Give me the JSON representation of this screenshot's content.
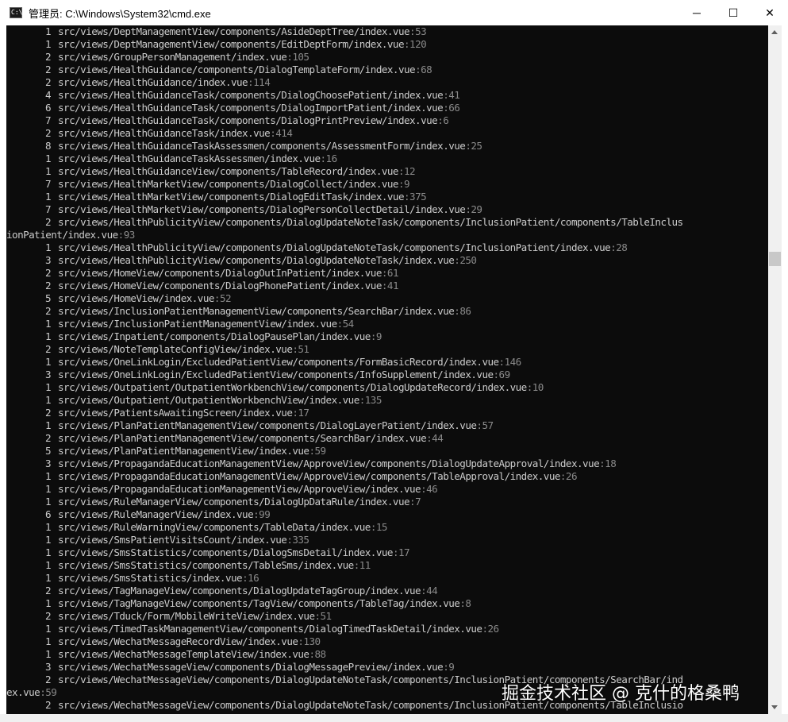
{
  "window": {
    "title": "管理员: C:\\Windows\\System32\\cmd.exe",
    "icon": "cmd-icon",
    "minimize": "─",
    "maximize": "☐",
    "close": "✕"
  },
  "colors": {
    "console_bg": "#0c0c0c",
    "console_text": "#cccccc",
    "line_number_text": "#8a8a8a"
  },
  "lines": [
    {
      "count": "1",
      "path": "src/views/DeptManagementView/components/AsideDeptTree/index.vue",
      "ln": ":53"
    },
    {
      "count": "1",
      "path": "src/views/DeptManagementView/components/EditDeptForm/index.vue",
      "ln": ":120"
    },
    {
      "count": "2",
      "path": "src/views/GroupPersonManagement/index.vue",
      "ln": ":105"
    },
    {
      "count": "2",
      "path": "src/views/HealthGuidance/components/DialogTemplateForm/index.vue",
      "ln": ":68"
    },
    {
      "count": "2",
      "path": "src/views/HealthGuidance/index.vue",
      "ln": ":114"
    },
    {
      "count": "4",
      "path": "src/views/HealthGuidanceTask/components/DialogChoosePatient/index.vue",
      "ln": ":41"
    },
    {
      "count": "6",
      "path": "src/views/HealthGuidanceTask/components/DialogImportPatient/index.vue",
      "ln": ":66"
    },
    {
      "count": "7",
      "path": "src/views/HealthGuidanceTask/components/DialogPrintPreview/index.vue",
      "ln": ":6"
    },
    {
      "count": "2",
      "path": "src/views/HealthGuidanceTask/index.vue",
      "ln": ":414"
    },
    {
      "count": "8",
      "path": "src/views/HealthGuidanceTaskAssessmen/components/AssessmentForm/index.vue",
      "ln": ":25"
    },
    {
      "count": "1",
      "path": "src/views/HealthGuidanceTaskAssessmen/index.vue",
      "ln": ":16"
    },
    {
      "count": "1",
      "path": "src/views/HealthGuidanceView/components/TableRecord/index.vue",
      "ln": ":12"
    },
    {
      "count": "7",
      "path": "src/views/HealthMarketView/components/DialogCollect/index.vue",
      "ln": ":9"
    },
    {
      "count": "1",
      "path": "src/views/HealthMarketView/components/DialogEditTask/index.vue",
      "ln": ":375"
    },
    {
      "count": "7",
      "path": "src/views/HealthMarketView/components/DialogPersonCollectDetail/index.vue",
      "ln": ":29"
    },
    {
      "count": "2",
      "path": "src/views/HealthPublicityView/components/DialogUpdateNoteTask/components/InclusionPatient/components/TableInclus",
      "ln": ""
    },
    {
      "count": "",
      "path": "ionPatient/index.vue",
      "ln": ":93"
    },
    {
      "count": "1",
      "path": "src/views/HealthPublicityView/components/DialogUpdateNoteTask/components/InclusionPatient/index.vue",
      "ln": ":28"
    },
    {
      "count": "3",
      "path": "src/views/HealthPublicityView/components/DialogUpdateNoteTask/index.vue",
      "ln": ":250"
    },
    {
      "count": "2",
      "path": "src/views/HomeView/components/DialogOutInPatient/index.vue",
      "ln": ":61"
    },
    {
      "count": "2",
      "path": "src/views/HomeView/components/DialogPhonePatient/index.vue",
      "ln": ":41"
    },
    {
      "count": "5",
      "path": "src/views/HomeView/index.vue",
      "ln": ":52"
    },
    {
      "count": "2",
      "path": "src/views/InclusionPatientManagementView/components/SearchBar/index.vue",
      "ln": ":86"
    },
    {
      "count": "1",
      "path": "src/views/InclusionPatientManagementView/index.vue",
      "ln": ":54"
    },
    {
      "count": "1",
      "path": "src/views/Inpatient/components/DialogPausePlan/index.vue",
      "ln": ":9"
    },
    {
      "count": "2",
      "path": "src/views/NoteTemplateConfigView/index.vue",
      "ln": ":51"
    },
    {
      "count": "1",
      "path": "src/views/OneLinkLogin/ExcludedPatientView/components/FormBasicRecord/index.vue",
      "ln": ":146"
    },
    {
      "count": "3",
      "path": "src/views/OneLinkLogin/ExcludedPatientView/components/InfoSupplement/index.vue",
      "ln": ":69"
    },
    {
      "count": "1",
      "path": "src/views/Outpatient/OutpatientWorkbenchView/components/DialogUpdateRecord/index.vue",
      "ln": ":10"
    },
    {
      "count": "1",
      "path": "src/views/Outpatient/OutpatientWorkbenchView/index.vue",
      "ln": ":135"
    },
    {
      "count": "2",
      "path": "src/views/PatientsAwaitingScreen/index.vue",
      "ln": ":17"
    },
    {
      "count": "1",
      "path": "src/views/PlanPatientManagementView/components/DialogLayerPatient/index.vue",
      "ln": ":57"
    },
    {
      "count": "2",
      "path": "src/views/PlanPatientManagementView/components/SearchBar/index.vue",
      "ln": ":44"
    },
    {
      "count": "5",
      "path": "src/views/PlanPatientManagementView/index.vue",
      "ln": ":59"
    },
    {
      "count": "3",
      "path": "src/views/PropagandaEducationManagementView/ApproveView/components/DialogUpdateApproval/index.vue",
      "ln": ":18"
    },
    {
      "count": "1",
      "path": "src/views/PropagandaEducationManagementView/ApproveView/components/TableApproval/index.vue",
      "ln": ":26"
    },
    {
      "count": "1",
      "path": "src/views/PropagandaEducationManagementView/ApproveView/index.vue",
      "ln": ":46"
    },
    {
      "count": "1",
      "path": "src/views/RuleManagerView/components/DialogUpDataRule/index.vue",
      "ln": ":7"
    },
    {
      "count": "6",
      "path": "src/views/RuleManagerView/index.vue",
      "ln": ":99"
    },
    {
      "count": "1",
      "path": "src/views/RuleWarningView/components/TableData/index.vue",
      "ln": ":15"
    },
    {
      "count": "1",
      "path": "src/views/SmsPatientVisitsCount/index.vue",
      "ln": ":335"
    },
    {
      "count": "1",
      "path": "src/views/SmsStatistics/components/DialogSmsDetail/index.vue",
      "ln": ":17"
    },
    {
      "count": "1",
      "path": "src/views/SmsStatistics/components/TableSms/index.vue",
      "ln": ":11"
    },
    {
      "count": "1",
      "path": "src/views/SmsStatistics/index.vue",
      "ln": ":16"
    },
    {
      "count": "2",
      "path": "src/views/TagManageView/components/DialogUpdateTagGroup/index.vue",
      "ln": ":44"
    },
    {
      "count": "1",
      "path": "src/views/TagManageView/components/TagView/components/TableTag/index.vue",
      "ln": ":8"
    },
    {
      "count": "2",
      "path": "src/views/Tduck/Form/MobileWriteView/index.vue",
      "ln": ":51"
    },
    {
      "count": "1",
      "path": "src/views/TimedTaskManagementView/components/DialogTimedTaskDetail/index.vue",
      "ln": ":26"
    },
    {
      "count": "1",
      "path": "src/views/WechatMessageRecordView/index.vue",
      "ln": ":130"
    },
    {
      "count": "1",
      "path": "src/views/WechatMessageTemplateView/index.vue",
      "ln": ":88"
    },
    {
      "count": "3",
      "path": "src/views/WechatMessageView/components/DialogMessagePreview/index.vue",
      "ln": ":9"
    },
    {
      "count": "2",
      "path": "src/views/WechatMessageView/components/DialogUpdateNoteTask/components/InclusionPatient/components/SearchBar/ind",
      "ln": ""
    },
    {
      "count": "",
      "path": "ex.vue",
      "ln": ":59"
    },
    {
      "count": "2",
      "path": "src/views/WechatMessageView/components/DialogUpdateNoteTask/components/InclusionPatient/components/TableInclusio",
      "ln": ""
    }
  ],
  "watermark": "掘金技术社区 @ 克什的格桑鸭"
}
